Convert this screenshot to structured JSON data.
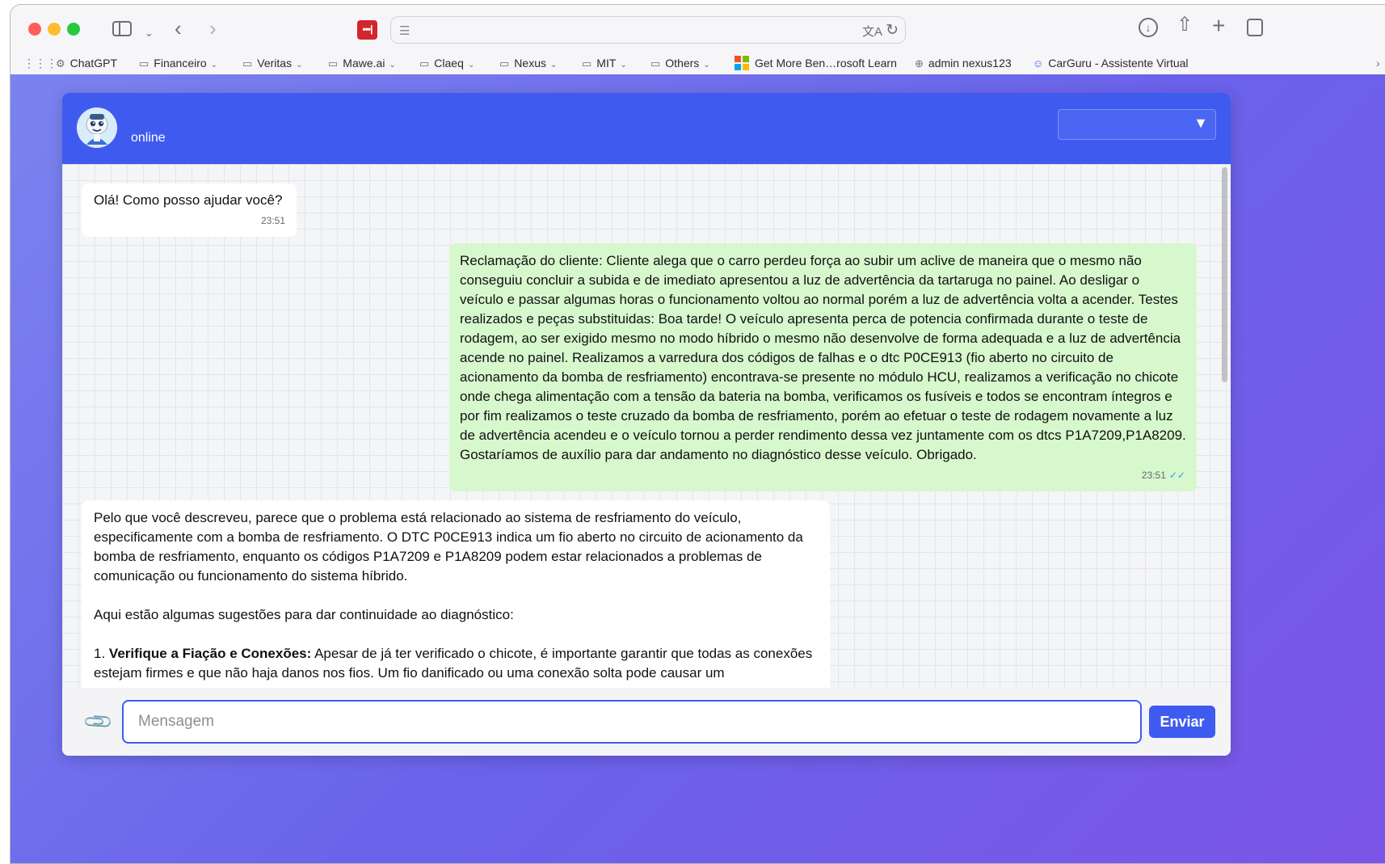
{
  "browser": {
    "address_text": "",
    "bookmarks": [
      {
        "label": "ChatGPT",
        "icon": "openai-icon",
        "folder": false
      },
      {
        "label": "Financeiro",
        "icon": "folder-icon",
        "folder": true
      },
      {
        "label": "Veritas",
        "icon": "folder-icon",
        "folder": true
      },
      {
        "label": "Mawe.ai",
        "icon": "folder-icon",
        "folder": true
      },
      {
        "label": "Claeq",
        "icon": "folder-icon",
        "folder": true
      },
      {
        "label": "Nexus",
        "icon": "folder-icon",
        "folder": true
      },
      {
        "label": "MIT",
        "icon": "folder-icon",
        "folder": true
      },
      {
        "label": "Others",
        "icon": "folder-icon",
        "folder": true
      },
      {
        "label": "Get More Ben…rosoft Learn",
        "icon": "microsoft-icon",
        "folder": false
      },
      {
        "label": "admin nexus123",
        "icon": "globe-icon",
        "folder": false
      },
      {
        "label": "CarGuru - Assistente Virtual",
        "icon": "carguru-icon",
        "folder": false
      }
    ]
  },
  "chat": {
    "status": "online",
    "selector_value": "",
    "messages": {
      "greeting": {
        "text": "Olá! Como posso ajudar você?",
        "time": "23:51"
      },
      "user": {
        "text": "Reclamação do cliente: Cliente alega que o carro perdeu força ao subir um aclive de maneira que o mesmo não conseguiu concluir a subida e de imediato apresentou a luz de advertência da tartaruga no painel. Ao desligar o veículo e passar algumas horas o funcionamento voltou ao normal porém a luz de advertência volta a acender. Testes realizados e peças substituidas: Boa tarde! O veículo apresenta perca de potencia confirmada durante o teste de rodagem, ao ser exigido mesmo no modo híbrido o mesmo não desenvolve de forma adequada e a luz de advertência acende no painel. Realizamos a varredura dos códigos de falhas e o dtc P0CE913 (fio aberto no circuito de acionamento da bomba de resfriamento) encontrava-se presente no módulo HCU, realizamos a verificação no chicote onde chega alimentação com a tensão da bateria na bomba, verificamos os fusíveis e todos se encontram íntegros e por fim realizamos o teste cruzado da bomba de resfriamento, porém ao efetuar o teste de rodagem novamente a luz de advertência acendeu e o veículo tornou a perder rendimento dessa vez juntamente com os dtcs P1A7209,P1A8209. Gostaríamos de auxílio para dar andamento no diagnóstico desse veículo. Obrigado.",
        "time": "23:51",
        "ticks": "✓✓"
      },
      "reply": {
        "p1": "Pelo que você descreveu, parece que o problema está relacionado ao sistema de resfriamento do veículo, especificamente com a bomba de resfriamento. O DTC P0CE913 indica um fio aberto no circuito de acionamento da bomba de resfriamento, enquanto os códigos P1A7209 e P1A8209 podem estar relacionados a problemas de comunicação ou funcionamento do sistema híbrido.",
        "p2": "Aqui estão algumas sugestões para dar continuidade ao diagnóstico:",
        "item1_number": "1.",
        "item1_title": "Verifique a Fiação e Conexões:",
        "item1_text": "Apesar de já ter verificado o chicote, é importante garantir que todas as conexões estejam firmes e que não haja danos nos fios. Um fio danificado ou uma conexão solta pode causar um"
      }
    },
    "input": {
      "placeholder": "Mensagem",
      "value": ""
    },
    "send_label": "Enviar",
    "colors": {
      "header": "#3f5bef",
      "user_bubble": "#d7f8cd",
      "background_gradient": "#6a62ea"
    }
  }
}
